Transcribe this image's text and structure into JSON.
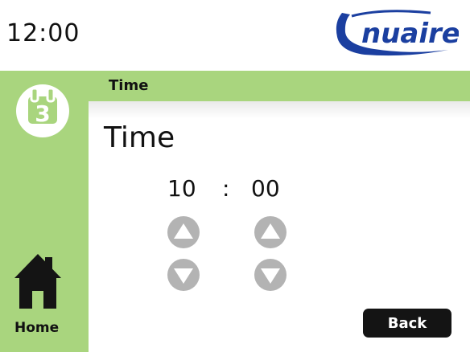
{
  "status": {
    "clock": "12:00"
  },
  "brand": {
    "logo_text": "nuaire",
    "color": "#1b3fa0"
  },
  "colors": {
    "accent_green": "#a9d57e",
    "button_dark": "#141414",
    "arrow_grey": "#b3b3b3"
  },
  "header": {
    "title": "Time"
  },
  "sidebar": {
    "calendar_icon": {
      "name": "calendar-icon",
      "day": "3"
    },
    "home": {
      "icon": "home-icon",
      "label": "Home"
    }
  },
  "main": {
    "title": "Time",
    "time": {
      "hours": "10",
      "separator": ":",
      "minutes": "00"
    }
  },
  "buttons": {
    "back_label": "Back"
  }
}
